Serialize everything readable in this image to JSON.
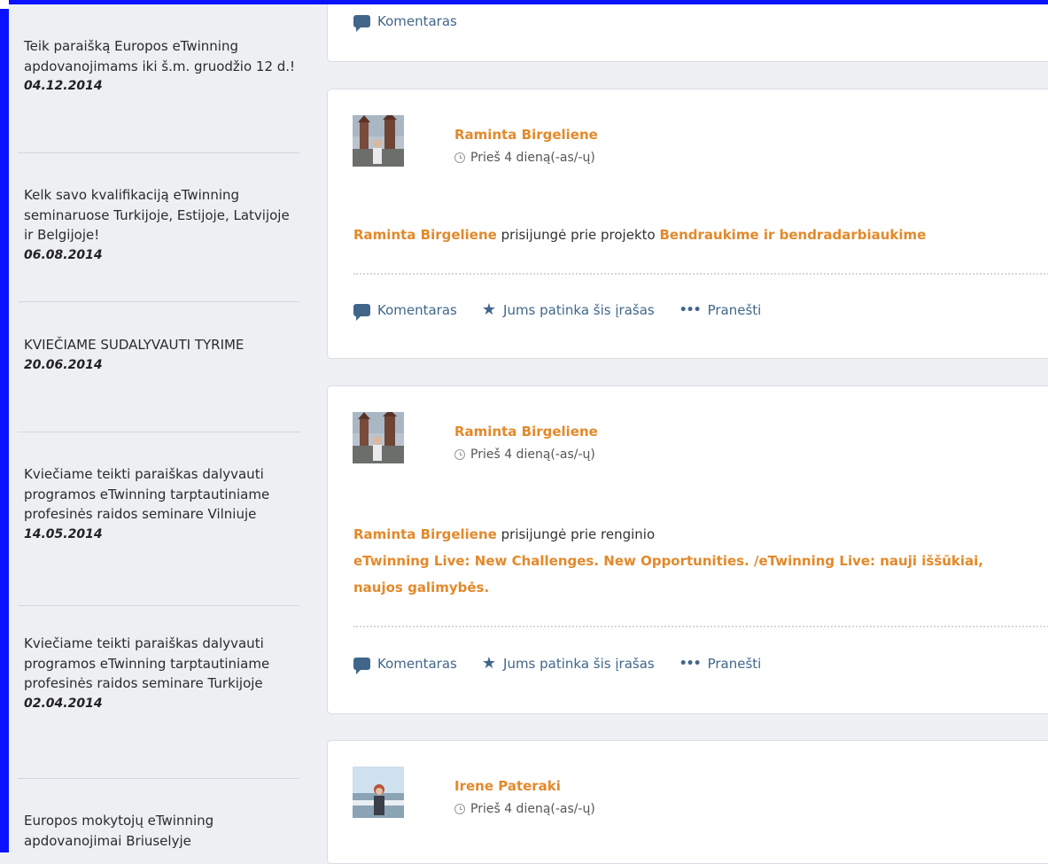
{
  "sidebar": {
    "items": [
      {
        "title": "Teik paraišką Europos eTwinning apdovanojimams iki š.m. gruodžio 12 d.!",
        "date": "04.12.2014"
      },
      {
        "title": "Kelk savo kvalifikaciją eTwinning seminaruose Turkijoje, Estijoje, Latvijoje ir Belgijoje!",
        "date": "06.08.2014"
      },
      {
        "title": "KVIEČIAME SUDALYVAUTI TYRIME",
        "date": "20.06.2014"
      },
      {
        "title": "Kviečiame teikti paraiškas dalyvauti programos eTwinning tarptautiniame profesinės raidos seminare Vilniuje",
        "date": "14.05.2014"
      },
      {
        "title": "Kviečiame teikti paraiškas dalyvauti programos eTwinning tarptautiniame profesinės raidos seminare Turkijoje",
        "date": "02.04.2014"
      },
      {
        "title": "Europos mokytojų eTwinning apdovanojimai Briuselyje",
        "date": ""
      }
    ]
  },
  "feed": {
    "top_card": {
      "comment_label": "Komentaras"
    },
    "posts": [
      {
        "author": "Raminta Birgeliene",
        "time": "Prieš 4 dieną(-as/-ų)",
        "actor": "Raminta Birgeliene",
        "verb": "prisijungė prie projekto",
        "target": "Bendraukime ir bendradarbiaukime",
        "comment_label": "Komentaras",
        "like_label": "Jums patinka šis įrašas",
        "report_label": "Pranešti"
      },
      {
        "author": "Raminta Birgeliene",
        "time": "Prieš 4 dieną(-as/-ų)",
        "actor": "Raminta Birgeliene",
        "verb": "prisijungė prie renginio",
        "target_line1": "eTwinning Live: New Challenges. New Opportunities. /eTwinning Live: nauji iššūkiai,",
        "target_line2": "naujos galimybės.",
        "comment_label": "Komentaras",
        "like_label": "Jums patinka šis įrašas",
        "report_label": "Pranešti"
      },
      {
        "author": "Irene Pateraki",
        "time": "Prieš 4 dieną(-as/-ų)"
      }
    ]
  },
  "colors": {
    "accent": "#e3892b",
    "action": "#41668a",
    "frame": "#0a12ff"
  }
}
